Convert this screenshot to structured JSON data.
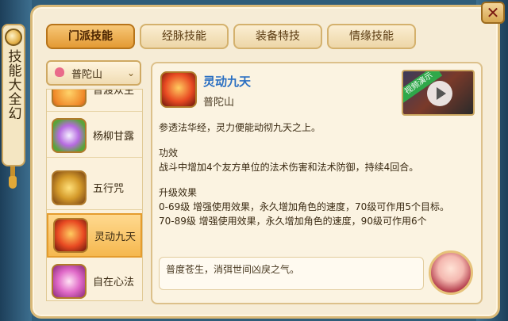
{
  "window": {
    "title": "技能大全幻",
    "close_label": "✕"
  },
  "tabs": [
    {
      "label": "门派技能",
      "active": true
    },
    {
      "label": "经脉技能",
      "active": false
    },
    {
      "label": "装备特技",
      "active": false
    },
    {
      "label": "情缘技能",
      "active": false
    }
  ],
  "sect_dropdown": {
    "selected": "普陀山",
    "chevron": "⌄",
    "icon": "lotus-icon"
  },
  "skills": [
    {
      "name": "普渡众生",
      "icon": "lotus-flame-icon"
    },
    {
      "name": "杨柳甘露",
      "icon": "willow-icon"
    },
    {
      "name": "五行咒",
      "icon": "five-elements-icon"
    },
    {
      "name": "灵动九天",
      "icon": "flying-spirit-icon",
      "active": true
    },
    {
      "name": "自在心法",
      "icon": "free-mind-icon"
    }
  ],
  "detail": {
    "title": "灵动九天",
    "sect": "普陀山",
    "video_tag": "视频演示",
    "description": "参透法华经，灵力便能动彻九天之上。",
    "effect_heading": "功效",
    "effect_text": "战斗中增加4个友方单位的法术伤害和法术防御，持续4回合。",
    "upgrade_heading": "升级效果",
    "upgrade_line1": "0-69级 增强使用效果，永久增加角色的速度，70级可作用5个目标。",
    "upgrade_line2": "70-89级 增强使用效果，永久增加角色的速度，90级可作用6个",
    "quote": "普度苍生，消弭世间凶戾之气。"
  }
}
